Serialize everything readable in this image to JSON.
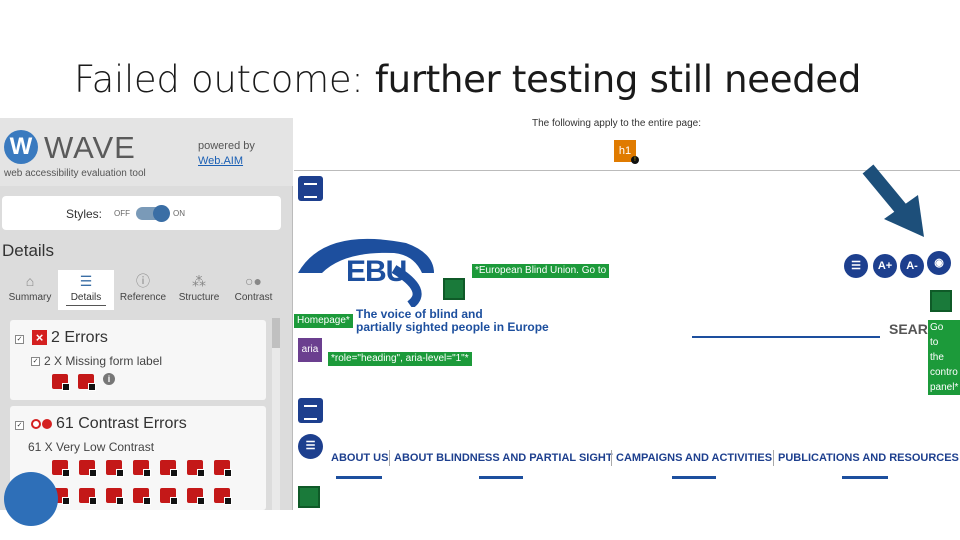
{
  "slide": {
    "title_prefix": "Failed outcome: ",
    "title_emph": "further testing still needed"
  },
  "wave": {
    "logo_letter": "W",
    "name": "WAVE",
    "subtitle": "web accessibility evaluation tool",
    "powered_by": "powered by",
    "webaim_link": "Web.AIM",
    "styles_label": "Styles:",
    "off": "OFF",
    "on": "ON",
    "details_heading": "Details",
    "tabs": [
      {
        "label": "Summary",
        "icon": "home-icon"
      },
      {
        "label": "Details",
        "icon": "list-icon"
      },
      {
        "label": "Reference",
        "icon": "info-icon"
      },
      {
        "label": "Structure",
        "icon": "structure-icon"
      },
      {
        "label": "Contrast",
        "icon": "contrast-icon"
      }
    ],
    "errors": {
      "title": "2 Errors",
      "item": "2 X Missing form label"
    },
    "contrast": {
      "title": "61 Contrast Errors",
      "item": "61 X Very Low Contrast"
    }
  },
  "web": {
    "entire_page_note": "The following apply to the entire page:",
    "h1_badge": "h1",
    "ebu_logo_text": "EBU",
    "green_label_1": "*European Blind Union. Go to",
    "homepage_label": "Homepage*",
    "voice_text_1": "The voice of blind and",
    "voice_text_2": "partially sighted people in Europe",
    "aria_badge": "aria",
    "role_label": "*role=\"heading\", aria-level=\"1\"*",
    "search_text": "SEARCH",
    "font_plus": "A+",
    "font_minus": "A-",
    "control_label_lines": [
      "Go",
      "to",
      "the",
      "contro",
      "panel*"
    ],
    "nav": [
      "ABOUT US",
      "ABOUT BLINDNESS AND PARTIAL SIGHT",
      "CAMPAIGNS AND ACTIVITIES",
      "PUBLICATIONS AND RESOURCES"
    ]
  },
  "colors": {
    "wave_blue": "#3a7abf",
    "error_red": "#d42020",
    "wave_green": "#1c9a3a",
    "ebu_blue": "#1d4f9e",
    "arrow_blue": "#1d4f7a"
  }
}
